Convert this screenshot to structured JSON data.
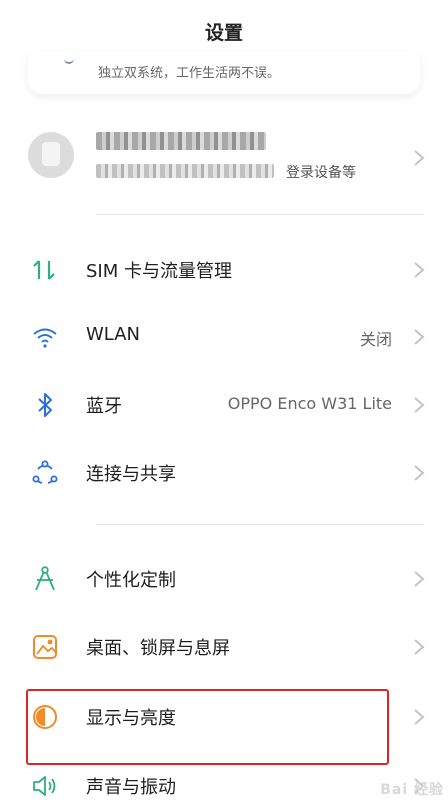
{
  "header": {
    "title": "设置"
  },
  "top_card": {
    "subtitle": "独立双系统，工作生活两不误。"
  },
  "account": {
    "info_suffix": "登录设备等"
  },
  "rows": [
    {
      "label": "SIM 卡与流量管理",
      "value": "",
      "icon": "sim-data-icon"
    },
    {
      "label": "WLAN",
      "value": "关闭",
      "icon": "wifi-icon"
    },
    {
      "label": "蓝牙",
      "value": "OPPO Enco W31 Lite",
      "icon": "bluetooth-icon"
    },
    {
      "label": "连接与共享",
      "value": "",
      "icon": "connection-share-icon"
    },
    {
      "label": "个性化定制",
      "value": "",
      "icon": "personalize-icon"
    },
    {
      "label": "桌面、锁屏与息屏",
      "value": "",
      "icon": "desktop-lock-icon"
    },
    {
      "label": "显示与亮度",
      "value": "",
      "icon": "display-brightness-icon"
    },
    {
      "label": "声音与振动",
      "value": "",
      "icon": "sound-vibration-icon"
    }
  ],
  "colors": {
    "icon_green": "#2fae7e",
    "icon_blue": "#2f6fd8",
    "icon_orange": "#f08a2a",
    "highlight_red": "#e0232a"
  },
  "watermark": "Bai 经验"
}
